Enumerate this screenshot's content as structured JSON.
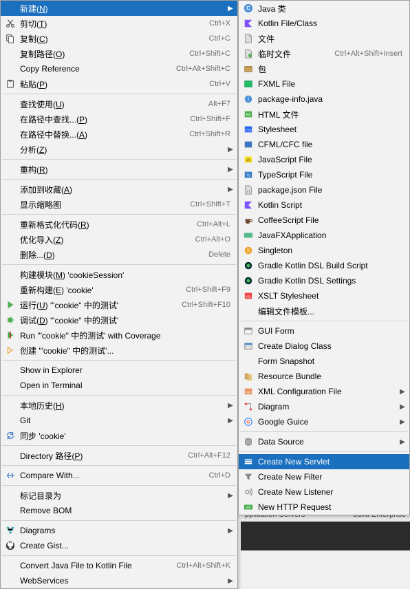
{
  "left_menu": [
    {
      "type": "item",
      "label": "新建(N)",
      "icon": "",
      "highlight": true,
      "arrow": true
    },
    {
      "type": "item",
      "label": "剪切(T)",
      "icon": "cut",
      "shortcut": "Ctrl+X"
    },
    {
      "type": "item",
      "label": "复制(C)",
      "icon": "copy",
      "shortcut": "Ctrl+C"
    },
    {
      "type": "item",
      "label": "复制路径(O)",
      "icon": "",
      "shortcut": "Ctrl+Shift+C"
    },
    {
      "type": "item",
      "label": "Copy Reference",
      "icon": "",
      "shortcut": "Ctrl+Alt+Shift+C"
    },
    {
      "type": "item",
      "label": "粘贴(P)",
      "icon": "paste",
      "shortcut": "Ctrl+V"
    },
    {
      "type": "sep"
    },
    {
      "type": "item",
      "label": "查找使用(U)",
      "icon": "",
      "shortcut": "Alt+F7"
    },
    {
      "type": "item",
      "label": "在路径中查找...(P)",
      "icon": "",
      "shortcut": "Ctrl+Shift+F"
    },
    {
      "type": "item",
      "label": "在路径中替换...(A)",
      "icon": "",
      "shortcut": "Ctrl+Shift+R"
    },
    {
      "type": "item",
      "label": "分析(Z)",
      "icon": "",
      "arrow": true
    },
    {
      "type": "sep"
    },
    {
      "type": "item",
      "label": "重构(R)",
      "icon": "",
      "arrow": true
    },
    {
      "type": "sep"
    },
    {
      "type": "item",
      "label": "添加到收藏(A)",
      "icon": "",
      "arrow": true
    },
    {
      "type": "item",
      "label": "显示缩略图",
      "icon": "",
      "shortcut": "Ctrl+Shift+T"
    },
    {
      "type": "sep"
    },
    {
      "type": "item",
      "label": "重新格式化代码(R)",
      "icon": "",
      "shortcut": "Ctrl+Alt+L"
    },
    {
      "type": "item",
      "label": "优化导入(Z)",
      "icon": "",
      "shortcut": "Ctrl+Alt+O"
    },
    {
      "type": "item",
      "label": "删除...(D)",
      "icon": "",
      "shortcut": "Delete"
    },
    {
      "type": "sep"
    },
    {
      "type": "item",
      "label": "构建模块(M) 'cookieSession'",
      "icon": ""
    },
    {
      "type": "item",
      "label": "重新构建(E) 'cookie'",
      "icon": "",
      "shortcut": "Ctrl+Shift+F9"
    },
    {
      "type": "item",
      "label": "运行(U) '\"cookie\" 中的测试'",
      "icon": "run",
      "shortcut": "Ctrl+Shift+F10"
    },
    {
      "type": "item",
      "label": "调试(D) '\"cookie\" 中的测试'",
      "icon": "debug"
    },
    {
      "type": "item",
      "label": "Run '\"cookie\" 中的测试' with Coverage",
      "icon": "coverage"
    },
    {
      "type": "item",
      "label": "创建 '\"cookie\" 中的测试'...",
      "icon": "create-run"
    },
    {
      "type": "sep"
    },
    {
      "type": "item",
      "label": "Show in Explorer",
      "icon": ""
    },
    {
      "type": "item",
      "label": "Open in Terminal",
      "icon": ""
    },
    {
      "type": "sep"
    },
    {
      "type": "item",
      "label": "本地历史(H)",
      "icon": "",
      "arrow": true
    },
    {
      "type": "item",
      "label": "Git",
      "icon": "",
      "arrow": true
    },
    {
      "type": "item",
      "label": "同步 'cookie'",
      "icon": "sync"
    },
    {
      "type": "sep"
    },
    {
      "type": "item",
      "label": "Directory 路径(P)",
      "icon": "",
      "shortcut": "Ctrl+Alt+F12"
    },
    {
      "type": "sep"
    },
    {
      "type": "item",
      "label": "Compare With...",
      "icon": "compare",
      "shortcut": "Ctrl+D"
    },
    {
      "type": "sep"
    },
    {
      "type": "item",
      "label": "标记目录为",
      "icon": "",
      "arrow": true
    },
    {
      "type": "item",
      "label": "Remove BOM",
      "icon": ""
    },
    {
      "type": "sep"
    },
    {
      "type": "item",
      "label": "Diagrams",
      "icon": "diagram",
      "arrow": true
    },
    {
      "type": "item",
      "label": "Create Gist...",
      "icon": "github"
    },
    {
      "type": "sep"
    },
    {
      "type": "item",
      "label": "Convert Java File to Kotlin File",
      "icon": "",
      "shortcut": "Ctrl+Alt+Shift+K"
    },
    {
      "type": "item",
      "label": "WebServices",
      "icon": "",
      "arrow": true
    }
  ],
  "right_menu": [
    {
      "type": "item",
      "label": "Java 类",
      "icon": "java-class"
    },
    {
      "type": "item",
      "label": "Kotlin File/Class",
      "icon": "kotlin"
    },
    {
      "type": "item",
      "label": "文件",
      "icon": "file"
    },
    {
      "type": "item",
      "label": "临时文件",
      "icon": "scratch",
      "shortcut": "Ctrl+Alt+Shift+Insert"
    },
    {
      "type": "item",
      "label": "包",
      "icon": "package"
    },
    {
      "type": "item",
      "label": "FXML File",
      "icon": "fxml"
    },
    {
      "type": "item",
      "label": "package-info.java",
      "icon": "pkg-info"
    },
    {
      "type": "item",
      "label": "HTML 文件",
      "icon": "html"
    },
    {
      "type": "item",
      "label": "Stylesheet",
      "icon": "css"
    },
    {
      "type": "item",
      "label": "CFML/CFC file",
      "icon": "cfml"
    },
    {
      "type": "item",
      "label": "JavaScript File",
      "icon": "js"
    },
    {
      "type": "item",
      "label": "TypeScript File",
      "icon": "ts"
    },
    {
      "type": "item",
      "label": "package.json File",
      "icon": "json"
    },
    {
      "type": "item",
      "label": "Kotlin Script",
      "icon": "kotlin"
    },
    {
      "type": "item",
      "label": "CoffeeScript File",
      "icon": "coffee"
    },
    {
      "type": "item",
      "label": "JavaFXApplication",
      "icon": "javafx"
    },
    {
      "type": "item",
      "label": "Singleton",
      "icon": "singleton"
    },
    {
      "type": "item",
      "label": "Gradle Kotlin DSL Build Script",
      "icon": "gradle"
    },
    {
      "type": "item",
      "label": "Gradle Kotlin DSL Settings",
      "icon": "gradle"
    },
    {
      "type": "item",
      "label": "XSLT Stylesheet",
      "icon": "xslt"
    },
    {
      "type": "item",
      "label": "编辑文件模板...",
      "icon": ""
    },
    {
      "type": "sep"
    },
    {
      "type": "item",
      "label": "GUI Form",
      "icon": "gui"
    },
    {
      "type": "item",
      "label": "Create Dialog Class",
      "icon": "dialog"
    },
    {
      "type": "item",
      "label": "Form Snapshot",
      "icon": ""
    },
    {
      "type": "item",
      "label": "Resource Bundle",
      "icon": "bundle"
    },
    {
      "type": "item",
      "label": "XML Configuration File",
      "icon": "xml",
      "arrow": true
    },
    {
      "type": "item",
      "label": "Diagram",
      "icon": "diagram2",
      "arrow": true
    },
    {
      "type": "item",
      "label": "Google Guice",
      "icon": "guice",
      "arrow": true
    },
    {
      "type": "sep"
    },
    {
      "type": "item",
      "label": "Data Source",
      "icon": "datasource",
      "arrow": true
    },
    {
      "type": "sep"
    },
    {
      "type": "item",
      "label": "Create New Servlet",
      "icon": "servlet",
      "highlight": true
    },
    {
      "type": "item",
      "label": "Create New Filter",
      "icon": "filter"
    },
    {
      "type": "item",
      "label": "Create New Listener",
      "icon": "listener"
    },
    {
      "type": "item",
      "label": "New HTTP Request",
      "icon": "api"
    }
  ],
  "status": {
    "left": "pplication Servers",
    "right": "Java Enterprise"
  }
}
